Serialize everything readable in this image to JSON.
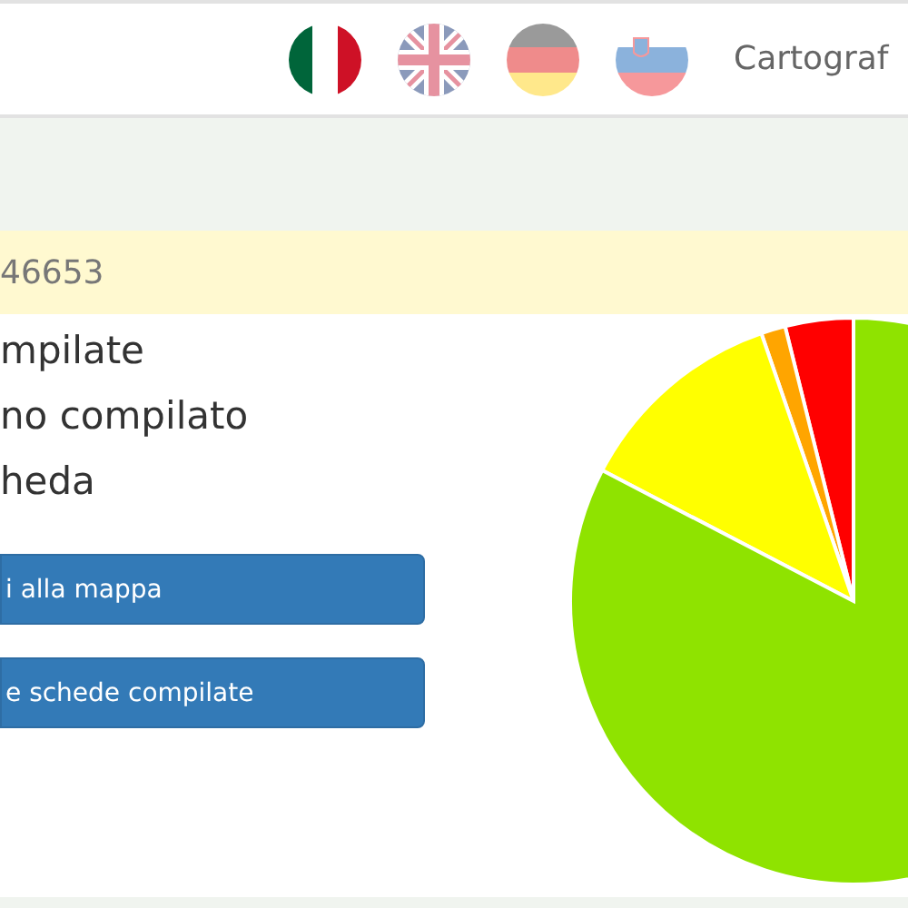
{
  "header": {
    "languages": [
      {
        "kind": "italy",
        "selected": true
      },
      {
        "kind": "uk",
        "selected": false
      },
      {
        "kind": "germany",
        "selected": false
      },
      {
        "kind": "slovenia",
        "selected": false
      }
    ],
    "brand": "Cartograf"
  },
  "notice": "46653",
  "summary": [
    "mpilate",
    "no compilato",
    "heda"
  ],
  "buttons": [
    "i alla mappa",
    "e schede compilate"
  ],
  "chart": {
    "kind": "picture"
  }
}
